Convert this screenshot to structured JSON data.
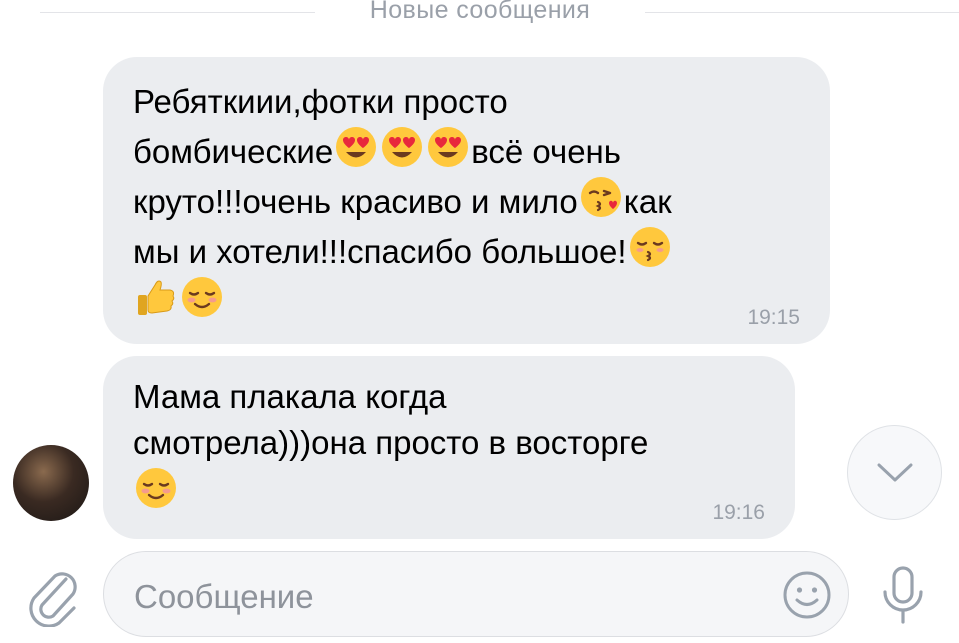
{
  "divider": {
    "label": "Новые сообщения"
  },
  "messages": [
    {
      "lines": [
        [
          {
            "t": "Ребяткиии,фотки просто"
          }
        ],
        [
          {
            "t": "бомбические"
          },
          {
            "e": "heart-eyes-emoji"
          },
          {
            "e": "heart-eyes-emoji"
          },
          {
            "e": "heart-eyes-emoji"
          },
          {
            "t": "всё очень"
          }
        ],
        [
          {
            "t": "круто!!!очень красиво и мило"
          },
          {
            "e": "kissing-heart-emoji"
          },
          {
            "t": "как"
          }
        ],
        [
          {
            "t": "мы и хотели!!!спасибо большое!"
          },
          {
            "e": "kissing-closed-eyes-emoji"
          }
        ],
        [
          {
            "e": "thumbs-up-emoji"
          },
          {
            "e": "smiling-blush-emoji"
          }
        ]
      ],
      "time": "19:15"
    },
    {
      "lines": [
        [
          {
            "t": "Мама плакала когда"
          }
        ],
        [
          {
            "t": "смотрела)))она просто в восторге"
          }
        ],
        [
          {
            "e": "smiling-blush-emoji"
          }
        ]
      ],
      "time": "19:16"
    }
  ],
  "composer": {
    "placeholder": "Сообщение"
  },
  "icons": {
    "attach": "paperclip-icon",
    "emoji": "smile-icon",
    "mic": "microphone-icon",
    "scroll": "chevron-down-icon"
  },
  "colors": {
    "bubble": "#ebedf0",
    "muted_text": "#9aa0a9",
    "icon_gray": "#99a2ad",
    "emoji_yellow": "#ffc83d",
    "heart_red": "#e8283c"
  }
}
